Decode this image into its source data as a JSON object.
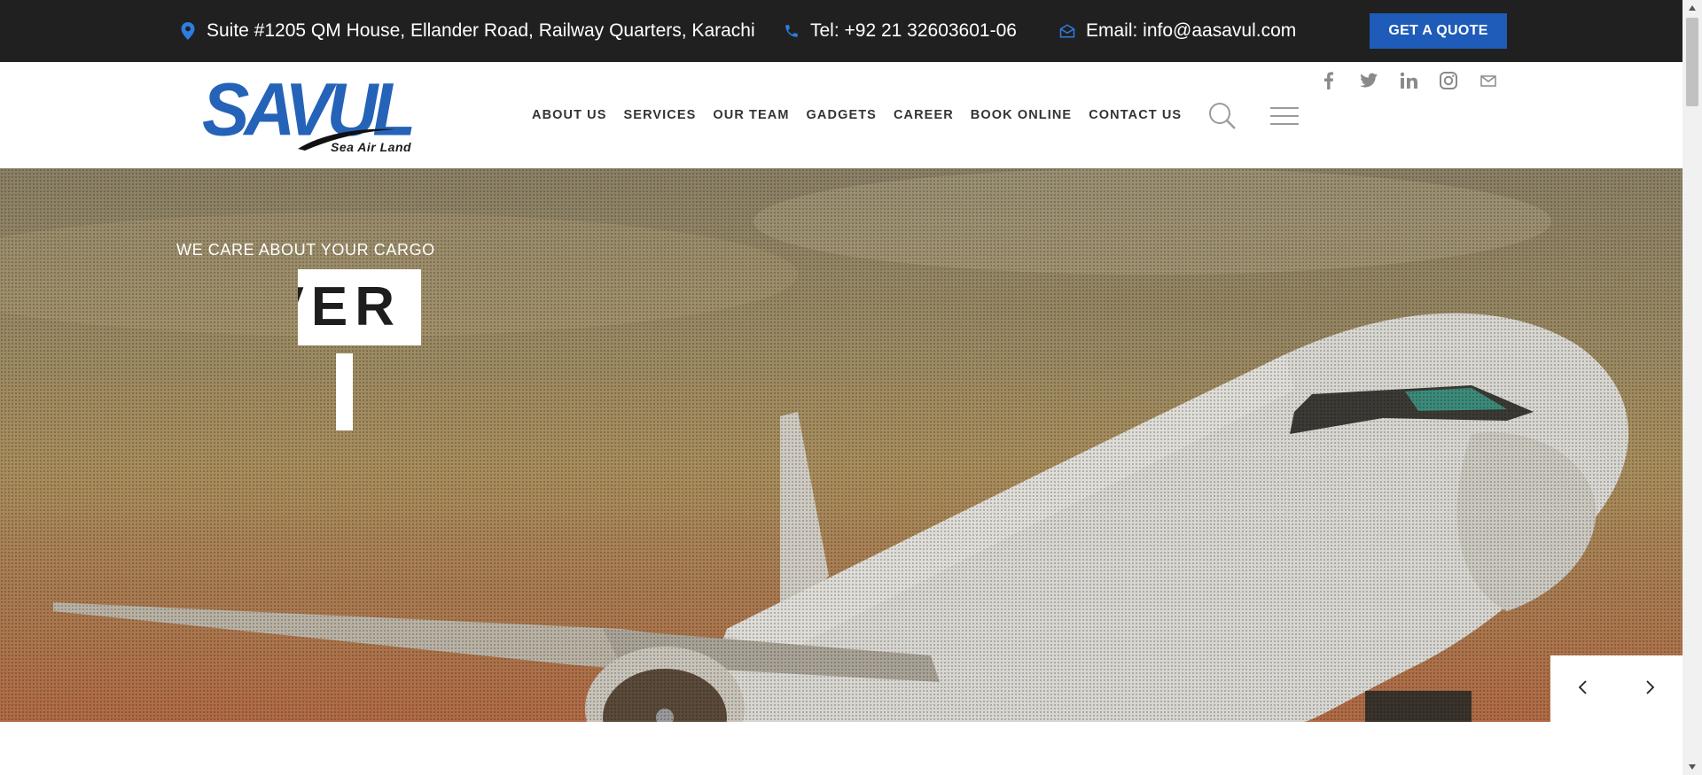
{
  "topbar": {
    "address": "Suite #1205 QM House, Ellander Road, Railway Quarters, Karachi",
    "phone": "Tel: +92 21 32603601-06",
    "email": "Email: info@aasavul.com",
    "quote_label": "GET A QUOTE",
    "icons": [
      "map-pin-icon",
      "phone-icon",
      "envelope-icon"
    ]
  },
  "header": {
    "logo_text": "SAVUL",
    "logo_tagline": "Sea Air Land",
    "nav": [
      "ABOUT US",
      "SERVICES",
      "OUR TEAM",
      "GADGETS",
      "CAREER",
      "BOOK ONLINE",
      "CONTACT US"
    ],
    "social": [
      "facebook-icon",
      "twitter-icon",
      "linkedin-icon",
      "instagram-icon",
      "mail-icon"
    ]
  },
  "hero": {
    "eyebrow": "WE CARE ABOUT YOUR CARGO",
    "headline_fragment": "VER",
    "slider_controls": [
      "chevron-left-icon",
      "chevron-right-icon"
    ]
  },
  "colors": {
    "topbar_bg": "#202020",
    "accent": "#1f5bb8",
    "logo_blue": "#2563b8",
    "nav_text": "#333333"
  }
}
